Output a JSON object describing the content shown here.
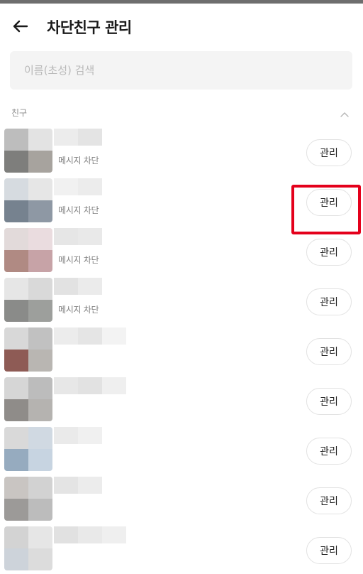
{
  "header": {
    "title": "차단친구 관리",
    "back_icon": "arrow-left-icon"
  },
  "search": {
    "placeholder": "이름(초성) 검색",
    "value": ""
  },
  "section": {
    "label": "친구",
    "collapse_icon": "chevron-up-icon"
  },
  "friends": [
    {
      "status": "메시지 차단",
      "action_label": "관리"
    },
    {
      "status": "메시지 차단",
      "action_label": "관리"
    },
    {
      "status": "메시지 차단",
      "action_label": "관리"
    },
    {
      "status": "메시지 차단",
      "action_label": "관리"
    },
    {
      "status": "",
      "action_label": "관리"
    },
    {
      "status": "",
      "action_label": "관리"
    },
    {
      "status": "",
      "action_label": "관리"
    },
    {
      "status": "",
      "action_label": "관리"
    },
    {
      "status": "",
      "action_label": "관리"
    }
  ],
  "highlight_color": "#e4001b"
}
